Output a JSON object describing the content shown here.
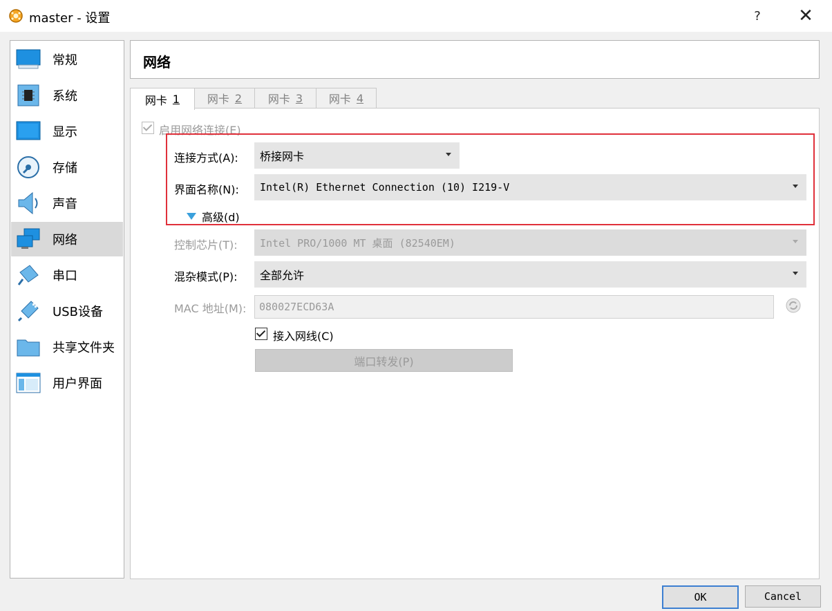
{
  "window": {
    "title": "master - 设置",
    "help_glyph": "?",
    "close_glyph": "✕"
  },
  "sidebar": {
    "items": [
      {
        "label": "常规",
        "icon": "general-icon"
      },
      {
        "label": "系统",
        "icon": "system-icon"
      },
      {
        "label": "显示",
        "icon": "display-icon"
      },
      {
        "label": "存储",
        "icon": "storage-icon"
      },
      {
        "label": "声音",
        "icon": "audio-icon"
      },
      {
        "label": "网络",
        "icon": "network-icon",
        "selected": true
      },
      {
        "label": "串口",
        "icon": "serial-port-icon"
      },
      {
        "label": "USB设备",
        "icon": "usb-icon"
      },
      {
        "label": "共享文件夹",
        "icon": "shared-folder-icon"
      },
      {
        "label": "用户界面",
        "icon": "user-interface-icon"
      }
    ]
  },
  "page": {
    "title": "网络"
  },
  "tabs": [
    {
      "label": "网卡",
      "num": "1"
    },
    {
      "label": "网卡",
      "num": "2"
    },
    {
      "label": "网卡",
      "num": "3"
    },
    {
      "label": "网卡",
      "num": "4"
    }
  ],
  "adapter": {
    "enable_label": "启用网络连接(E)",
    "attached_label": "连接方式(A):",
    "attached_value": "桥接网卡",
    "name_label": "界面名称(N):",
    "name_value": "Intel(R) Ethernet Connection (10) I219-V",
    "advanced_label": "高级(d)",
    "type_label": "控制芯片(T):",
    "type_value": "Intel PRO/1000 MT 桌面 (82540EM)",
    "promisc_label": "混杂模式(P):",
    "promisc_value": "全部允许",
    "mac_label": "MAC 地址(M):",
    "mac_value": "080027ECD63A",
    "cable_label": "接入网线(C)",
    "port_forward_label": "端口转发(P)"
  },
  "buttons": {
    "ok": "OK",
    "cancel": "Cancel"
  },
  "colors": {
    "highlight": "#e0303a",
    "selected": "#d9d9d9",
    "accent": "#3c7fd1"
  }
}
